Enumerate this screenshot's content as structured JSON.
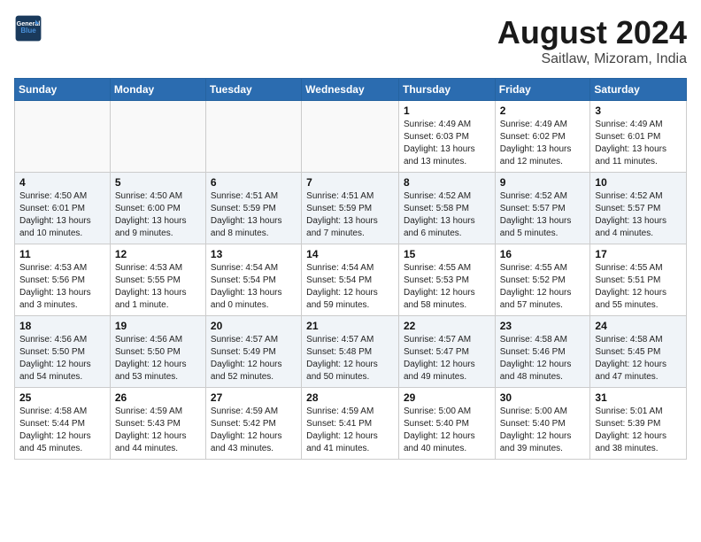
{
  "header": {
    "logo_line1": "General",
    "logo_line2": "Blue",
    "month_year": "August 2024",
    "location": "Saitlaw, Mizoram, India"
  },
  "weekdays": [
    "Sunday",
    "Monday",
    "Tuesday",
    "Wednesday",
    "Thursday",
    "Friday",
    "Saturday"
  ],
  "weeks": [
    [
      {
        "day": "",
        "info": ""
      },
      {
        "day": "",
        "info": ""
      },
      {
        "day": "",
        "info": ""
      },
      {
        "day": "",
        "info": ""
      },
      {
        "day": "1",
        "info": "Sunrise: 4:49 AM\nSunset: 6:03 PM\nDaylight: 13 hours\nand 13 minutes."
      },
      {
        "day": "2",
        "info": "Sunrise: 4:49 AM\nSunset: 6:02 PM\nDaylight: 13 hours\nand 12 minutes."
      },
      {
        "day": "3",
        "info": "Sunrise: 4:49 AM\nSunset: 6:01 PM\nDaylight: 13 hours\nand 11 minutes."
      }
    ],
    [
      {
        "day": "4",
        "info": "Sunrise: 4:50 AM\nSunset: 6:01 PM\nDaylight: 13 hours\nand 10 minutes."
      },
      {
        "day": "5",
        "info": "Sunrise: 4:50 AM\nSunset: 6:00 PM\nDaylight: 13 hours\nand 9 minutes."
      },
      {
        "day": "6",
        "info": "Sunrise: 4:51 AM\nSunset: 5:59 PM\nDaylight: 13 hours\nand 8 minutes."
      },
      {
        "day": "7",
        "info": "Sunrise: 4:51 AM\nSunset: 5:59 PM\nDaylight: 13 hours\nand 7 minutes."
      },
      {
        "day": "8",
        "info": "Sunrise: 4:52 AM\nSunset: 5:58 PM\nDaylight: 13 hours\nand 6 minutes."
      },
      {
        "day": "9",
        "info": "Sunrise: 4:52 AM\nSunset: 5:57 PM\nDaylight: 13 hours\nand 5 minutes."
      },
      {
        "day": "10",
        "info": "Sunrise: 4:52 AM\nSunset: 5:57 PM\nDaylight: 13 hours\nand 4 minutes."
      }
    ],
    [
      {
        "day": "11",
        "info": "Sunrise: 4:53 AM\nSunset: 5:56 PM\nDaylight: 13 hours\nand 3 minutes."
      },
      {
        "day": "12",
        "info": "Sunrise: 4:53 AM\nSunset: 5:55 PM\nDaylight: 13 hours\nand 1 minute."
      },
      {
        "day": "13",
        "info": "Sunrise: 4:54 AM\nSunset: 5:54 PM\nDaylight: 13 hours\nand 0 minutes."
      },
      {
        "day": "14",
        "info": "Sunrise: 4:54 AM\nSunset: 5:54 PM\nDaylight: 12 hours\nand 59 minutes."
      },
      {
        "day": "15",
        "info": "Sunrise: 4:55 AM\nSunset: 5:53 PM\nDaylight: 12 hours\nand 58 minutes."
      },
      {
        "day": "16",
        "info": "Sunrise: 4:55 AM\nSunset: 5:52 PM\nDaylight: 12 hours\nand 57 minutes."
      },
      {
        "day": "17",
        "info": "Sunrise: 4:55 AM\nSunset: 5:51 PM\nDaylight: 12 hours\nand 55 minutes."
      }
    ],
    [
      {
        "day": "18",
        "info": "Sunrise: 4:56 AM\nSunset: 5:50 PM\nDaylight: 12 hours\nand 54 minutes."
      },
      {
        "day": "19",
        "info": "Sunrise: 4:56 AM\nSunset: 5:50 PM\nDaylight: 12 hours\nand 53 minutes."
      },
      {
        "day": "20",
        "info": "Sunrise: 4:57 AM\nSunset: 5:49 PM\nDaylight: 12 hours\nand 52 minutes."
      },
      {
        "day": "21",
        "info": "Sunrise: 4:57 AM\nSunset: 5:48 PM\nDaylight: 12 hours\nand 50 minutes."
      },
      {
        "day": "22",
        "info": "Sunrise: 4:57 AM\nSunset: 5:47 PM\nDaylight: 12 hours\nand 49 minutes."
      },
      {
        "day": "23",
        "info": "Sunrise: 4:58 AM\nSunset: 5:46 PM\nDaylight: 12 hours\nand 48 minutes."
      },
      {
        "day": "24",
        "info": "Sunrise: 4:58 AM\nSunset: 5:45 PM\nDaylight: 12 hours\nand 47 minutes."
      }
    ],
    [
      {
        "day": "25",
        "info": "Sunrise: 4:58 AM\nSunset: 5:44 PM\nDaylight: 12 hours\nand 45 minutes."
      },
      {
        "day": "26",
        "info": "Sunrise: 4:59 AM\nSunset: 5:43 PM\nDaylight: 12 hours\nand 44 minutes."
      },
      {
        "day": "27",
        "info": "Sunrise: 4:59 AM\nSunset: 5:42 PM\nDaylight: 12 hours\nand 43 minutes."
      },
      {
        "day": "28",
        "info": "Sunrise: 4:59 AM\nSunset: 5:41 PM\nDaylight: 12 hours\nand 41 minutes."
      },
      {
        "day": "29",
        "info": "Sunrise: 5:00 AM\nSunset: 5:40 PM\nDaylight: 12 hours\nand 40 minutes."
      },
      {
        "day": "30",
        "info": "Sunrise: 5:00 AM\nSunset: 5:40 PM\nDaylight: 12 hours\nand 39 minutes."
      },
      {
        "day": "31",
        "info": "Sunrise: 5:01 AM\nSunset: 5:39 PM\nDaylight: 12 hours\nand 38 minutes."
      }
    ]
  ]
}
